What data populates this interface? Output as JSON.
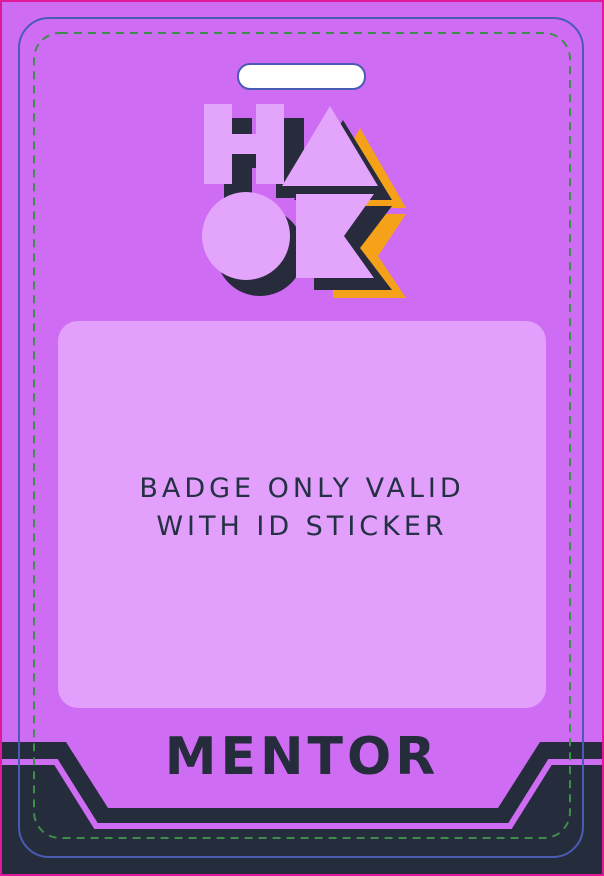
{
  "badge": {
    "notice_line_1": "BADGE ONLY VALID",
    "notice_line_2": "WITH ID STICKER",
    "role": "MENTOR",
    "logo_text": "HACK"
  },
  "colors": {
    "background": "#cf6cf4",
    "panel": "#e29ffc",
    "logo_light": "#e3a4fb",
    "logo_shadow": "#272b3b",
    "logo_accent": "#f5a11a",
    "dark": "#252c3b",
    "outline_blue": "#4a5bb3",
    "edge_pink": "#e0189a",
    "cut_line": "#3f8d4a"
  },
  "icons": {
    "slot": "lanyard-slot",
    "logo": "hack-geometric-logo"
  }
}
